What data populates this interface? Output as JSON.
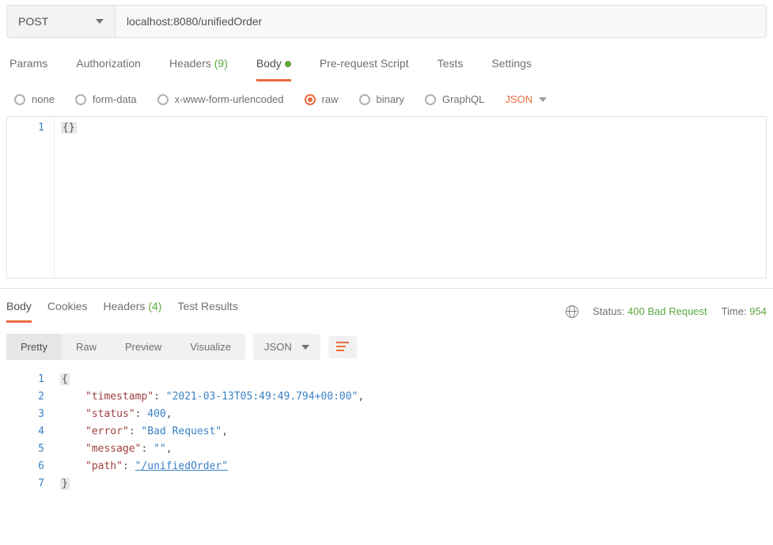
{
  "request": {
    "method": "POST",
    "url": "localhost:8080/unifiedOrder"
  },
  "tabs": {
    "params": "Params",
    "auth": "Authorization",
    "headers_label": "Headers",
    "headers_count": "(9)",
    "body": "Body",
    "prerequest": "Pre-request Script",
    "tests": "Tests",
    "settings": "Settings"
  },
  "body_types": {
    "none": "none",
    "formdata": "form-data",
    "urlencoded": "x-www-form-urlencoded",
    "raw": "raw",
    "binary": "binary",
    "graphql": "GraphQL",
    "format": "JSON"
  },
  "request_body": {
    "line1_num": "1",
    "line1_text": "{}"
  },
  "response_tabs": {
    "body": "Body",
    "cookies": "Cookies",
    "headers_label": "Headers",
    "headers_count": "(4)",
    "tests": "Test Results"
  },
  "response_meta": {
    "status_label": "Status:",
    "status_value": "400 Bad Request",
    "time_label": "Time:",
    "time_value": "954"
  },
  "view_controls": {
    "pretty": "Pretty",
    "raw": "Raw",
    "preview": "Preview",
    "visualize": "Visualize",
    "format": "JSON"
  },
  "response_body": {
    "ln1": "1",
    "ln2": "2",
    "ln3": "3",
    "ln4": "4",
    "ln5": "5",
    "ln6": "6",
    "ln7": "7",
    "open": "{",
    "k_timestamp": "\"timestamp\"",
    "v_timestamp": "\"2021-03-13T05:49:49.794+00:00\"",
    "k_status": "\"status\"",
    "v_status": "400",
    "k_error": "\"error\"",
    "v_error": "\"Bad Request\"",
    "k_message": "\"message\"",
    "v_message": "\"\"",
    "k_path": "\"path\"",
    "v_path": "\"/unifiedOrder\"",
    "close": "}",
    "colon": ": ",
    "comma": ","
  }
}
